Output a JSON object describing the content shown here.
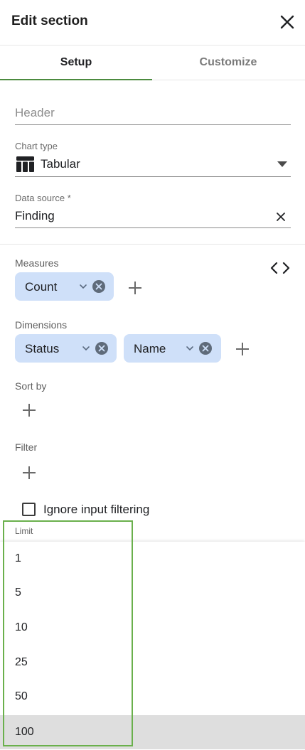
{
  "header": {
    "title": "Edit section",
    "close_icon": "close-icon"
  },
  "tabs": [
    {
      "label": "Setup",
      "active": true
    },
    {
      "label": "Customize",
      "active": false
    }
  ],
  "form": {
    "header_placeholder": "Header",
    "chart_type_label": "Chart type",
    "chart_type_value": "Tabular",
    "chart_type_icon": "table-icon",
    "data_source_label": "Data source *",
    "data_source_value": "Finding"
  },
  "measures": {
    "label": "Measures",
    "chips": [
      "Count"
    ]
  },
  "dimensions": {
    "label": "Dimensions",
    "chips": [
      "Status",
      "Name"
    ]
  },
  "sort_by": {
    "label": "Sort by"
  },
  "filter": {
    "label": "Filter"
  },
  "ignore_input_filtering": {
    "label": "Ignore input filtering",
    "checked": false
  },
  "limit": {
    "label": "Limit",
    "options": [
      "1",
      "5",
      "10",
      "25",
      "50",
      "100"
    ],
    "selected": "100"
  },
  "colors": {
    "accent": "#4c8b3f",
    "chip_bg": "#cfe0f9",
    "highlight": "#6ab04c",
    "selected_bg": "#dedede"
  }
}
